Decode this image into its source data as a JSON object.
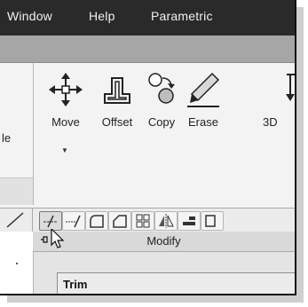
{
  "menubar": {
    "items": [
      "Window",
      "Help",
      "Parametric"
    ]
  },
  "ribbon": {
    "partial_left_label": "le",
    "tools": [
      {
        "label": "Move",
        "icon": "move-arrows-icon"
      },
      {
        "label": "Offset",
        "icon": "offset-icon"
      },
      {
        "label": "Copy",
        "icon": "copy-circles-icon"
      },
      {
        "label": "Erase",
        "icon": "erase-pencil-icon"
      },
      {
        "label": "3D",
        "icon": "3d-icon"
      }
    ],
    "small_tools": [
      "trim-icon",
      "extend-icon",
      "fillet-icon",
      "chamfer-icon",
      "array-icon",
      "mirror-icon",
      "align-icon",
      "partial-icon"
    ],
    "panel_title": "Modify"
  },
  "tooltip": {
    "title": "Trim"
  },
  "colors": {
    "menubar_bg": "#2a2a2a",
    "ribbon_bg": "#f3f3f3"
  }
}
